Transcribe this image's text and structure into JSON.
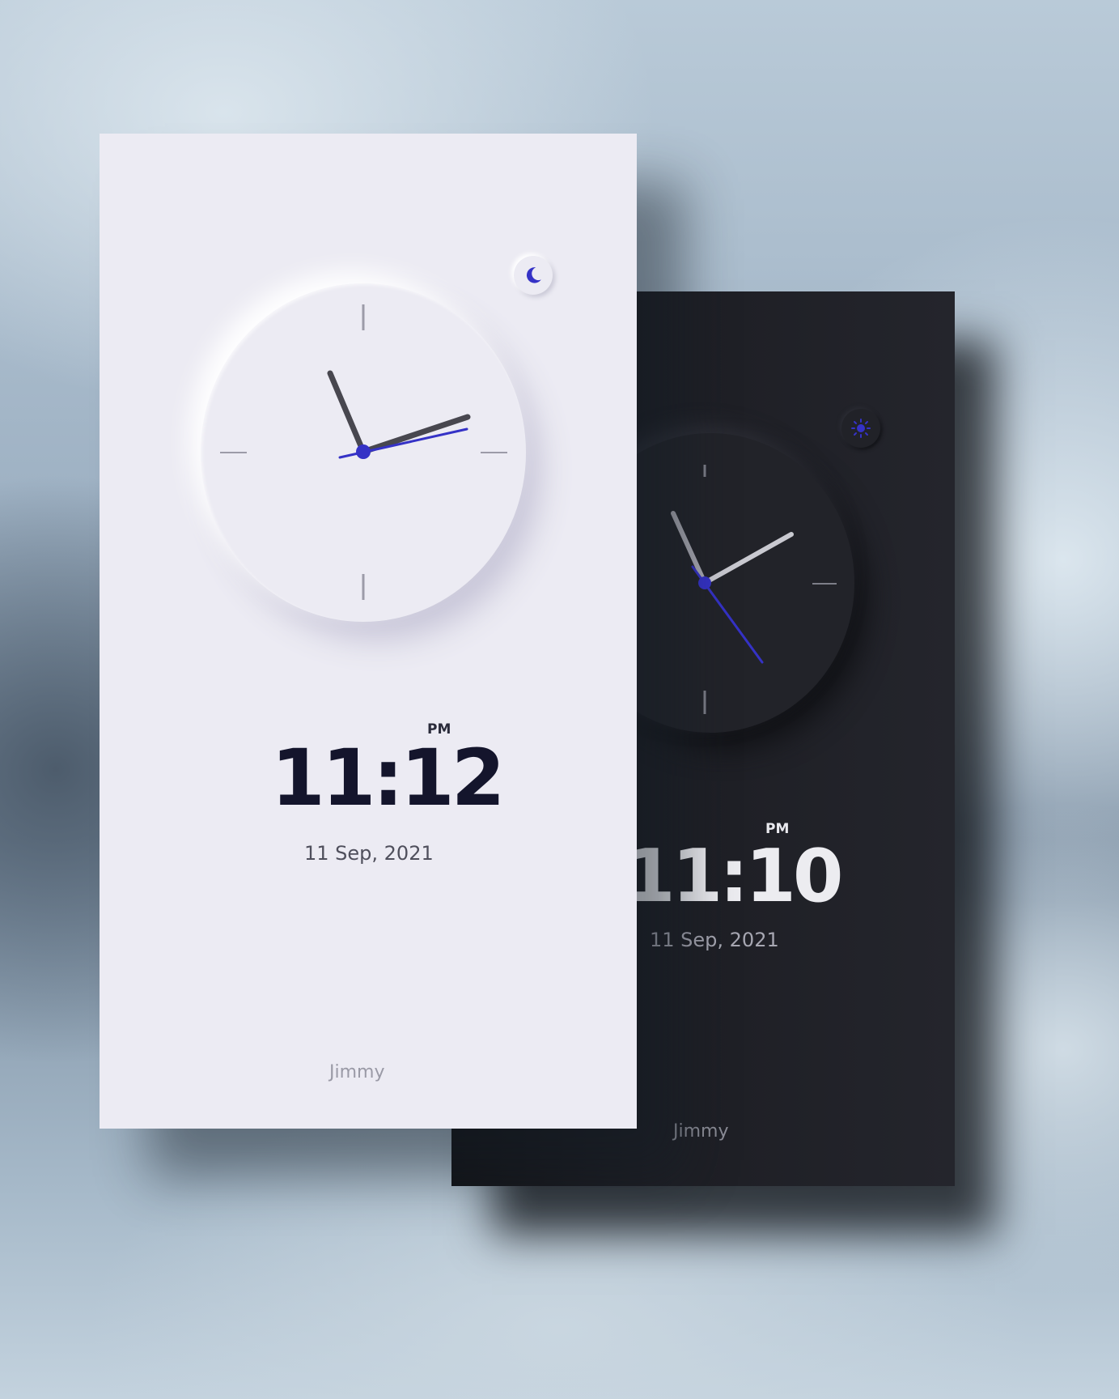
{
  "light_card": {
    "time": "11:12",
    "ampm": "PM",
    "date": "11 Sep, 2021",
    "name": "Jimmy",
    "toggle_icon": "moon-icon",
    "colors": {
      "background": "#ecebf3",
      "text": "#14152c",
      "accent": "#3532c6"
    }
  },
  "dark_card": {
    "time": "11:10",
    "ampm": "PM",
    "date": "11 Sep, 2021",
    "name": "Jimmy",
    "toggle_icon": "sun-icon",
    "colors": {
      "background": "#222329",
      "text": "#ececf0",
      "accent": "#3532c6"
    }
  }
}
